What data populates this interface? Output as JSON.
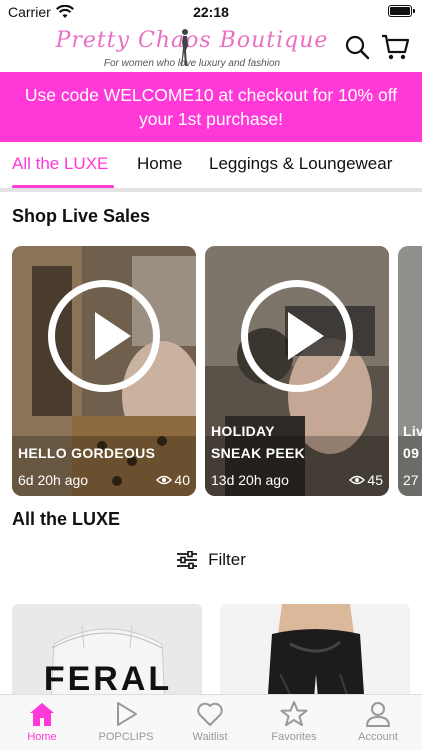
{
  "status_bar": {
    "carrier": "Carrier",
    "time": "22:18"
  },
  "header": {
    "logo_text": "Pretty Chaos Boutique",
    "tagline": "For women who love luxury and fashion"
  },
  "promo": {
    "text": "Use code WELCOME10 at checkout for 10% off your 1st purchase!"
  },
  "tabs": [
    {
      "label": "All the LUXE"
    },
    {
      "label": "Home"
    },
    {
      "label": "Leggings & Loungewear"
    }
  ],
  "live_sales": {
    "title": "Shop Live Sales",
    "items": [
      {
        "title_line1": "HELLO GORDEOUS",
        "title_line2": "",
        "age": "6d 20h ago",
        "views": "40"
      },
      {
        "title_line1": "HOLIDAY",
        "title_line2": "SNEAK PEEK",
        "age": "13d 20h ago",
        "views": "45"
      },
      {
        "title_line1": "Liv",
        "title_line2": "09",
        "age": "27",
        "views": ""
      }
    ]
  },
  "collection": {
    "title": "All the LUXE",
    "filter_label": "Filter"
  },
  "products": [
    {
      "text": "FERAL"
    },
    {
      "text": ""
    }
  ],
  "tabbar": [
    {
      "label": "Home"
    },
    {
      "label": "POPCLIPS"
    },
    {
      "label": "Waitlist"
    },
    {
      "label": "Favorites"
    },
    {
      "label": "Account"
    }
  ],
  "colors": {
    "accent": "#ff38d8",
    "inactive": "#999999",
    "divider": "#e3e3e3"
  }
}
